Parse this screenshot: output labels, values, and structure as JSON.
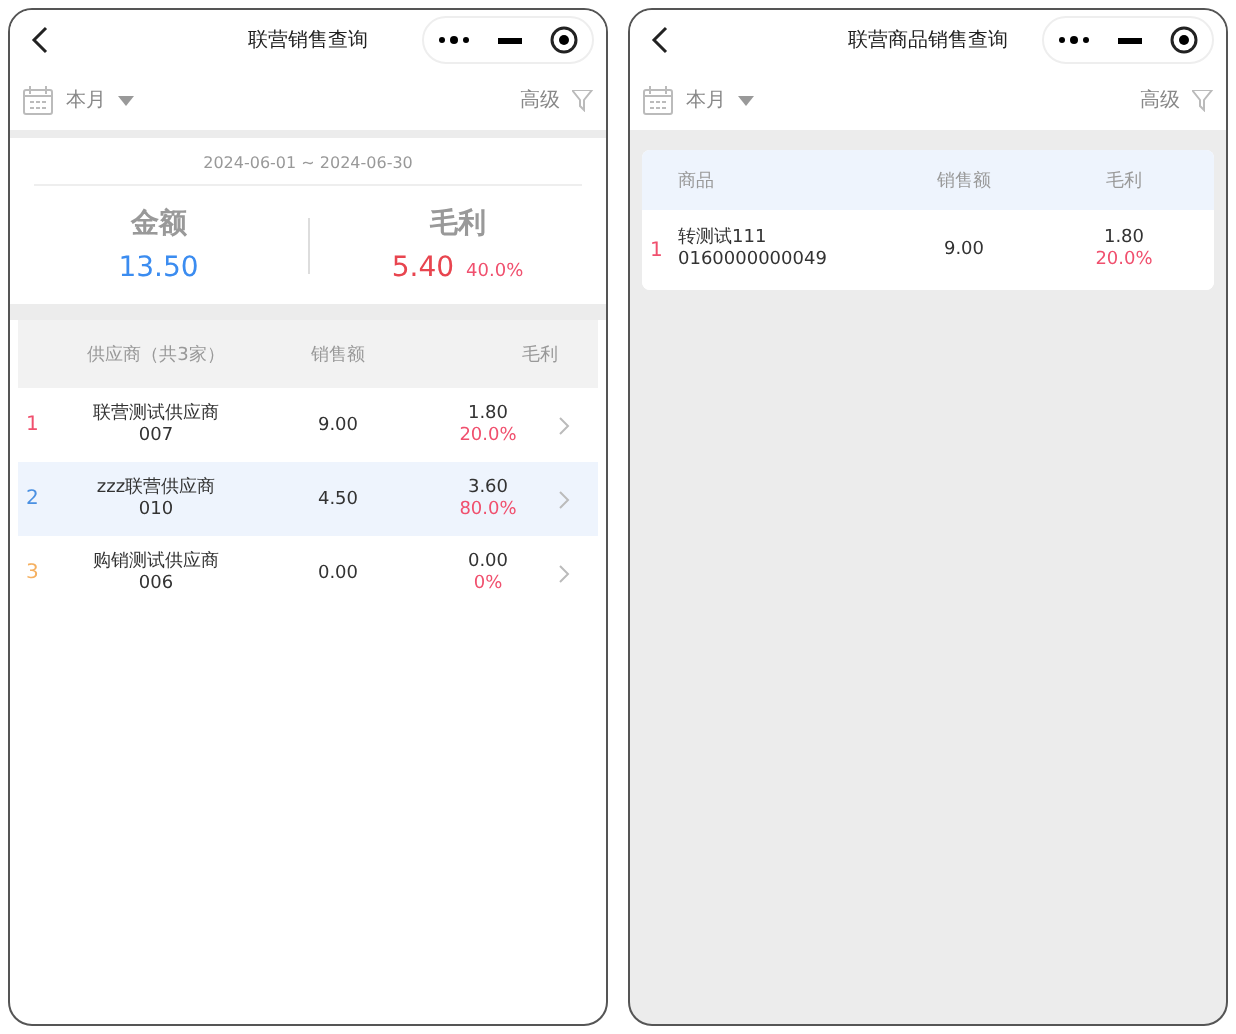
{
  "screens": [
    {
      "title": "联营销售查询",
      "period": "本月",
      "advanced": "高级",
      "date_range": "2024-06-01 ~ 2024-06-30",
      "summary": [
        {
          "label": "金额",
          "value": "13.50",
          "color": "#3b8cf0"
        },
        {
          "label": "毛利",
          "value": "5.40",
          "percent": "40.0%",
          "color": "#e8454f"
        }
      ],
      "table": {
        "kind": "supplier",
        "columns": [
          "供应商（共3家）",
          "销售额",
          "毛利"
        ],
        "rows": [
          {
            "rank": "1",
            "color": "#f0506e",
            "name": "联营测试供应商",
            "code": "007",
            "sales": "9.00",
            "profit": "1.80",
            "percent": "20.0%",
            "selected": false
          },
          {
            "rank": "2",
            "color": "#4a90e2",
            "name": "zzz联营供应商",
            "code": "010",
            "sales": "4.50",
            "profit": "3.60",
            "percent": "80.0%",
            "selected": true
          },
          {
            "rank": "3",
            "color": "#f5b060",
            "name": "购销测试供应商",
            "code": "006",
            "sales": "0.00",
            "profit": "0.00",
            "percent": "0%",
            "selected": false
          }
        ]
      }
    },
    {
      "title": "联营商品销售查询",
      "period": "本月",
      "advanced": "高级",
      "table": {
        "kind": "product",
        "columns": [
          "商品",
          "销售额",
          "毛利"
        ],
        "rows": [
          {
            "rank": "1",
            "color": "#f0506e",
            "name": "转测试111",
            "code": "0160000000049",
            "sales": "9.00",
            "profit": "1.80",
            "percent": "20.0%",
            "selected": false
          }
        ]
      }
    }
  ]
}
